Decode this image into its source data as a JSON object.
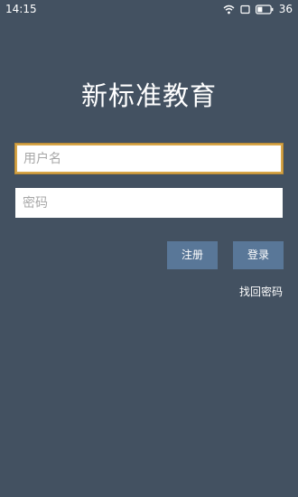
{
  "status_bar": {
    "time": "14:15",
    "battery": "36",
    "icons": [
      "wifi-icon",
      "screen-rotation-icon",
      "battery-icon"
    ]
  },
  "app": {
    "title": "新标准教育"
  },
  "form": {
    "username_placeholder": "用户名",
    "username_value": "",
    "password_placeholder": "密码",
    "password_value": ""
  },
  "buttons": {
    "register": "注册",
    "login": "登录"
  },
  "links": {
    "forgot_password": "找回密码"
  },
  "colors": {
    "background": "#435161",
    "button": "#597798",
    "focus_border": "#d7a547"
  }
}
